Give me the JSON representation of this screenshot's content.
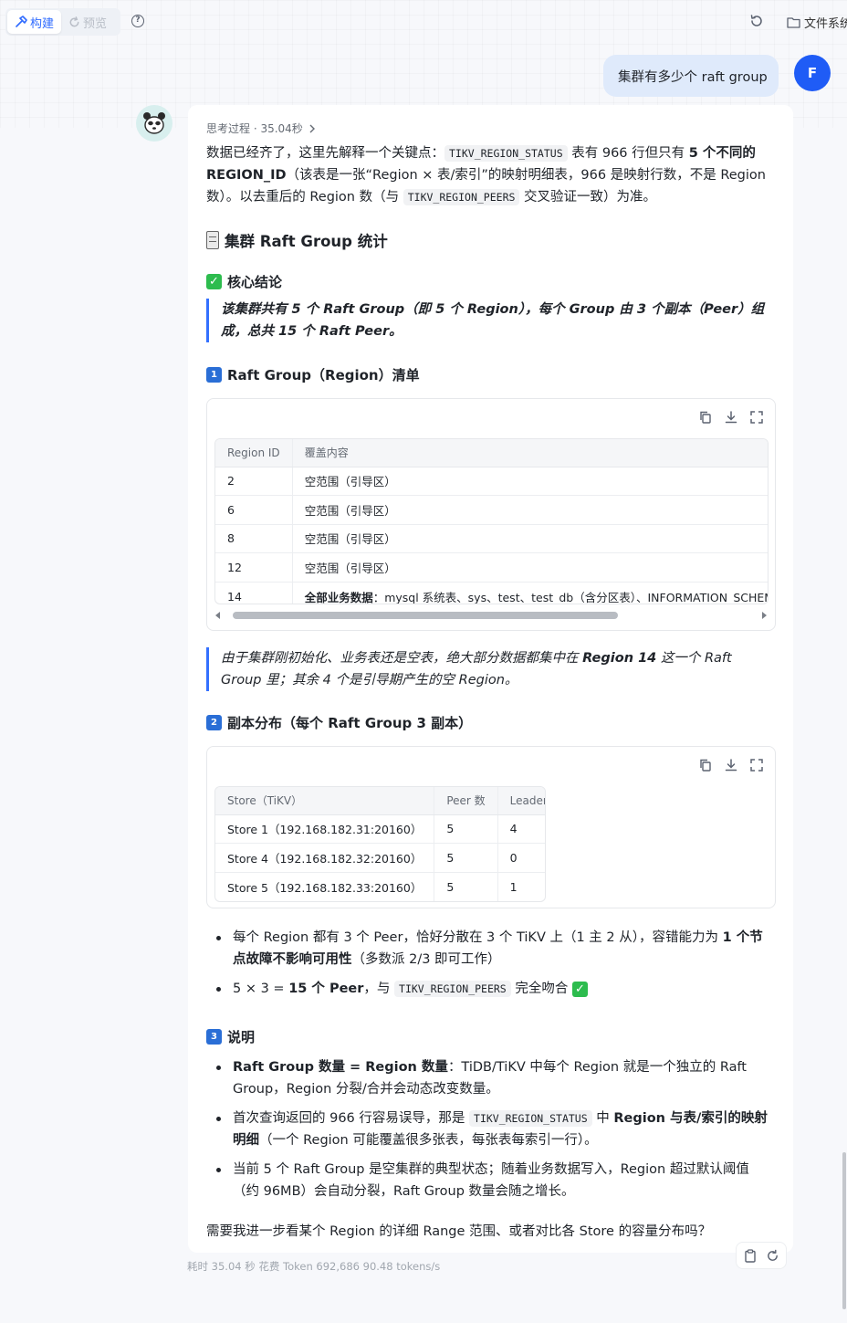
{
  "toolbar": {
    "build_label": "构建",
    "preview_label": "预览",
    "files_label": "文件系统"
  },
  "user_message": {
    "text": "集群有多少个 raft group",
    "avatar_letter": "F"
  },
  "assistant": {
    "thinking_label": "思考过程 · 35.04秒",
    "intro": {
      "p1": "数据已经齐了，这里先解释一个关键点：",
      "code1": "TIKV_REGION_STATUS",
      "p2": " 表有 966 行但只有 ",
      "b1": "5 个不同的 REGION_ID",
      "p3": "（该表是一张“Region × 表/索引”的映射明细表，966 是映射行数，不是 Region 数）。以去重后的 Region 数（与 ",
      "code2": "TIKV_REGION_PEERS",
      "p4": " 交叉验证一致）为准。"
    },
    "h_main": "集群 Raft Group 统计",
    "h_conclusion": "核心结论",
    "conclusion": "该集群共有 5 个 Raft Group（即 5 个 Region），每个 Group 由 3 个副本（Peer）组成，总共 15 个 Raft Peer。",
    "s1": {
      "badge": "1",
      "title": "Raft Group（Region）清单",
      "headers": [
        "Region ID",
        "覆盖内容"
      ],
      "rows": [
        {
          "id": "2",
          "content": "空范围（引导区）"
        },
        {
          "id": "6",
          "content": "空范围（引导区）"
        },
        {
          "id": "8",
          "content": "空范围（引导区）"
        },
        {
          "id": "12",
          "content": "空范围（引导区）"
        }
      ],
      "last_row": {
        "id": "14",
        "bold": "全部业务数据",
        "rest": "：mysql 系统表、sys、test、test_db（含分区表）、INFORMATION_SCHEMA"
      }
    },
    "note": {
      "pre": "由于集群刚初始化、业务表还是空表，绝大部分数据都集中在 ",
      "bold": "Region 14",
      "post": " 这一个 Raft Group 里；其余 4 个是引导期产生的空 Region。"
    },
    "s2": {
      "badge": "2",
      "title": "副本分布（每个 Raft Group 3 副本）",
      "headers": [
        "Store（TiKV）",
        "Peer 数",
        "Leader 数"
      ],
      "rows": [
        {
          "store": "Store 1（192.168.182.31:20160）",
          "peers": "5",
          "leaders": "4"
        },
        {
          "store": "Store 4（192.168.182.32:20160）",
          "peers": "5",
          "leaders": "0"
        },
        {
          "store": "Store 5（192.168.182.33:20160）",
          "peers": "5",
          "leaders": "1"
        }
      ]
    },
    "bullets2": {
      "b1_pre": "每个 Region 都有 3 个 Peer，恰好分散在 3 个 TiKV 上（1 主 2 从），容错能力为 ",
      "b1_bold": "1 个节点故障不影响可用性",
      "b1_post": "（多数派 2/3 即可工作）",
      "b2_pre": "5 × 3 = ",
      "b2_bold": "15 个 Peer",
      "b2_mid": "，与 ",
      "b2_code": "TIKV_REGION_PEERS",
      "b2_post": " 完全吻合 "
    },
    "s3": {
      "badge": "3",
      "title": "说明",
      "i1_bold": "Raft Group 数量 = Region 数量",
      "i1_rest": "：TiDB/TiKV 中每个 Region 就是一个独立的 Raft Group，Region 分裂/合并会动态改变数量。",
      "i2_pre": "首次查询返回的 966 行容易误导，那是 ",
      "i2_code": "TIKV_REGION_STATUS",
      "i2_mid": " 中 ",
      "i2_bold": "Region 与表/索引的映射明细",
      "i2_post": "（一个 Region 可能覆盖很多张表，每张表每索引一行）。",
      "i3": "当前 5 个 Raft Group 是空集群的典型状态；随着业务数据写入，Region 超过默认阈值（约 96MB）会自动分裂，Raft Group 数量会随之增长。"
    },
    "closing": "需要我进一步看某个 Region 的详细 Range 范围、或者对比各 Store 的容量分布吗？"
  },
  "footer": {
    "stats": "耗时 35.04 秒   花费 Token 692,686   90.48 tokens/s"
  },
  "colors": {
    "accent": "#2f6bff",
    "user_bubble": "#dfeafb",
    "avatar": "#1f5cf6",
    "quote_bar": "#3370ff",
    "check": "#2dbc4e"
  }
}
